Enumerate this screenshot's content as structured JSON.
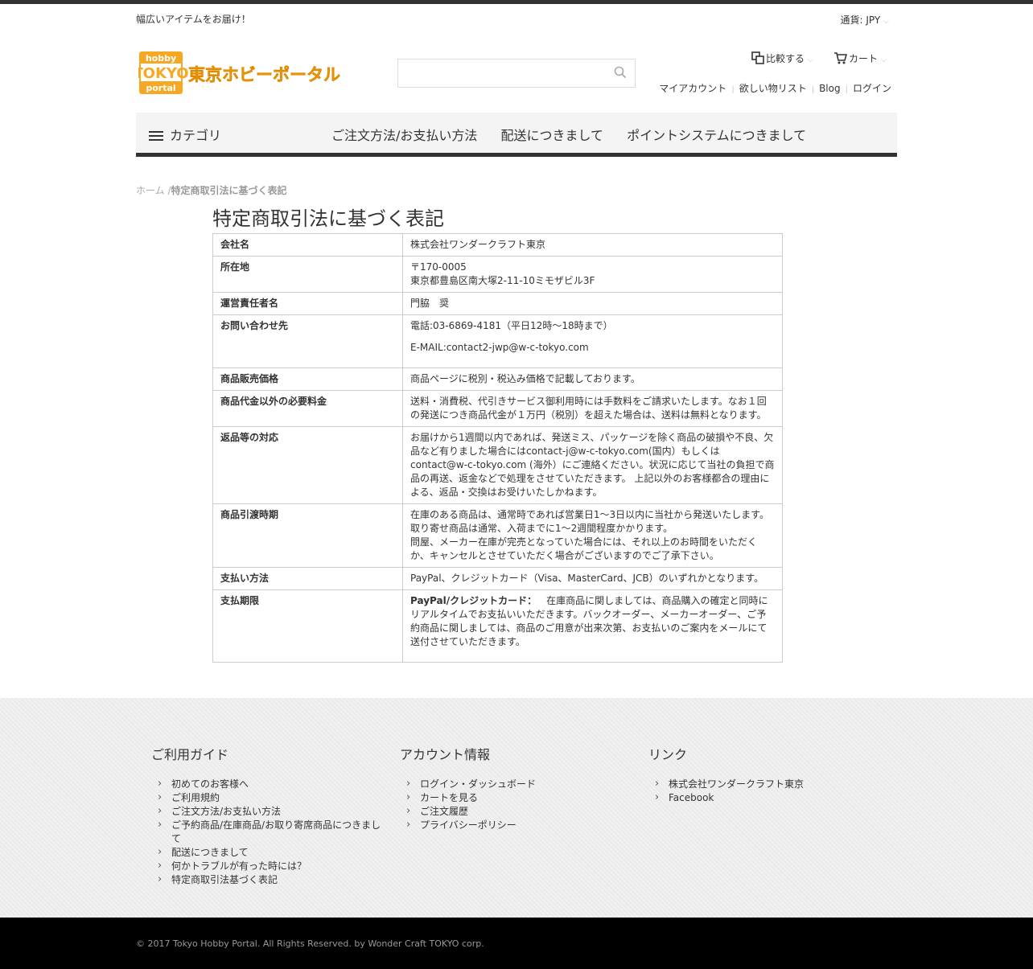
{
  "header": {
    "tagline": "幅広いアイテムをお届け！",
    "currency_label": "通貨: JPY",
    "logo_text": "東京ホビーポータル",
    "logo_badge": [
      "hobby",
      "TOKYO",
      "portal"
    ],
    "search_placeholder": "",
    "compare_label": "比較する",
    "cart_label": "カート",
    "account_links": [
      "マイアカウント",
      "欲しい物リスト",
      "Blog",
      "ログイン"
    ]
  },
  "nav": {
    "category_label": "カテゴリ",
    "items": [
      "ご注文方法/お支払い方法",
      "配送につきまして",
      "ポイントシステムにつきまして"
    ]
  },
  "breadcrumb": {
    "home": "ホーム",
    "sep": "/",
    "current": "特定商取引法に基づく表記"
  },
  "page": {
    "title": "特定商取引法に基づく表記",
    "rows": [
      {
        "label": "会社名",
        "lines": [
          "株式会社ワンダークラフト東京"
        ]
      },
      {
        "label": "所在地",
        "lines": [
          "〒170-0005",
          "東京都豊島区南大塚2-11-10ミモザビル3F"
        ]
      },
      {
        "label": "運営責任者名",
        "lines": [
          "門脇　奨"
        ]
      },
      {
        "label": "お問い合わせ先",
        "paras": [
          "電話:03-6869-4181（平日12時～18時まで）",
          "E-MAIL:contact2-jwp@w-c-tokyo.com"
        ]
      },
      {
        "label": "商品販売価格",
        "lines": [
          "商品ページに税別・税込み価格で記載しております。"
        ]
      },
      {
        "label": "商品代金以外の必要料金",
        "lines": [
          "送料・消費税、代引きサービス御利用時には手数料をご請求いたします。なお１回の発送につき商品代金が１万円（税別）を超えた場合は、送料は無料となります。"
        ]
      },
      {
        "label": "返品等の対応",
        "lines": [
          "お届けから1週間以内であれば、発送ミス、パッケージを除く商品の破損や不良、欠品など有りました場合にはcontact-j@w-c-tokyo.com(国内）もしくはcontact@w-c-tokyo.com (海外）にご連絡ください。状況に応じて当社の負担で商品の再送、返金などで処理をさせていただきます。 上記以外のお客様都合の理由による、返品・交換はお受けいたしかねます。"
        ]
      },
      {
        "label": "商品引渡時期",
        "lines": [
          "在庫のある商品は、通常時であれば営業日1～3日以内に当社から発送いたします。",
          "取り寄せ商品は通常、入荷までに1～2週間程度かかります。",
          "問屋、メーカー在庫が完売となっていた場合には、それ以上のお時間をいただくか、キャンセルとさせていただく場合がございますのでご了承下さい。"
        ]
      },
      {
        "label": "支払い方法",
        "lines": [
          "PayPal、クレジットカード（Visa、MasterCard、JCB）のいずれかとなります。"
        ]
      },
      {
        "label": "支払期限",
        "bold_prefix": "PayPal/クレジットカード：",
        "lines": [
          "在庫商品に関しましては、商品購入の確定と同時にリアルタイムでお支払いいただきます。バックオーダー、メーカーオーダー、ご予約商品に関しましては、商品のご用意が出来次第、お支払いのご案内をメールにて送付させていただきます。"
        ]
      }
    ]
  },
  "footer": {
    "columns": [
      {
        "title": "ご利用ガイド",
        "items": [
          "初めてのお客様へ",
          "ご利用規約",
          "ご注文方法/お支払い方法",
          "ご予約商品/在庫商品/お取り寄席商品につきまして",
          "配送につきまして",
          "何かトラブルが有った時には？",
          "特定商取引法基づく表記"
        ]
      },
      {
        "title": "アカウント情報",
        "items": [
          "ログイン・ダッシュボード",
          "カートを見る",
          "ご注文履歴",
          "プライバシーポリシー"
        ]
      },
      {
        "title": "リンク",
        "items": [
          "株式会社ワンダークラフト東京",
          "Facebook"
        ]
      }
    ],
    "copyright": "© 2017 Tokyo Hobby Portal. All Rights Reserved. by Wonder Craft TOKYO corp."
  },
  "colors": {
    "logo_orange": "#f7a823",
    "dark_bar": "#333333",
    "footer_bg": "#efefef"
  }
}
